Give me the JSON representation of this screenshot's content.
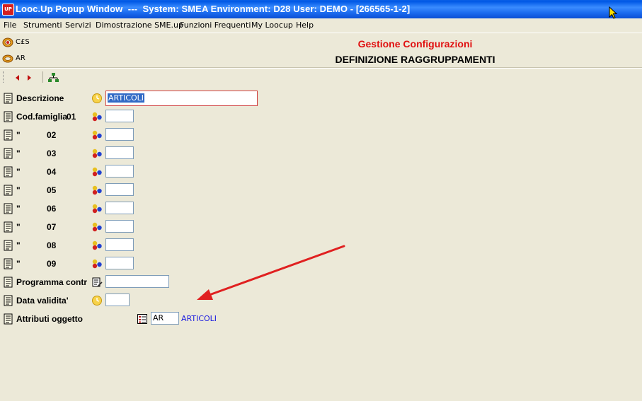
{
  "window": {
    "title": "Looc.Up Popup Window  ---  System: SMEA Environment: D28 User: DEMO - [266565-1-2]",
    "app_badge": "UP"
  },
  "menu": [
    "File",
    "Strumenti",
    "Servizi",
    "Dimostrazione SME.up",
    "Funzioni Frequenti",
    "My Loocup",
    "Help"
  ],
  "shortcuts": [
    {
      "label": "C£S",
      "icon": "help-ring-icon"
    },
    {
      "label": "AR",
      "icon": "ring-icon"
    }
  ],
  "header": {
    "title": "Gestione Configurazioni",
    "subtitle": "DEFINIZIONE RAGGRUPPAMENTI"
  },
  "form": {
    "descrizione": {
      "label": "Descrizione",
      "value": "ARTICOLI"
    },
    "cod_famiglia": {
      "label": "Cod.famiglia",
      "ditto": "\"",
      "numbers": [
        "01",
        "02",
        "03",
        "04",
        "05",
        "06",
        "07",
        "08",
        "09"
      ]
    },
    "programma": {
      "label": "Programma contr",
      "value": ""
    },
    "data_validita": {
      "label": "Data validita'",
      "value": ""
    },
    "attributi": {
      "label": "Attributi oggetto",
      "value": "AR",
      "description": "ARTICOLI"
    }
  },
  "colors": {
    "title_red": "#E01010",
    "link_blue": "#1A1AE0",
    "selection": "#316AC5",
    "arrow": "#E02020"
  }
}
